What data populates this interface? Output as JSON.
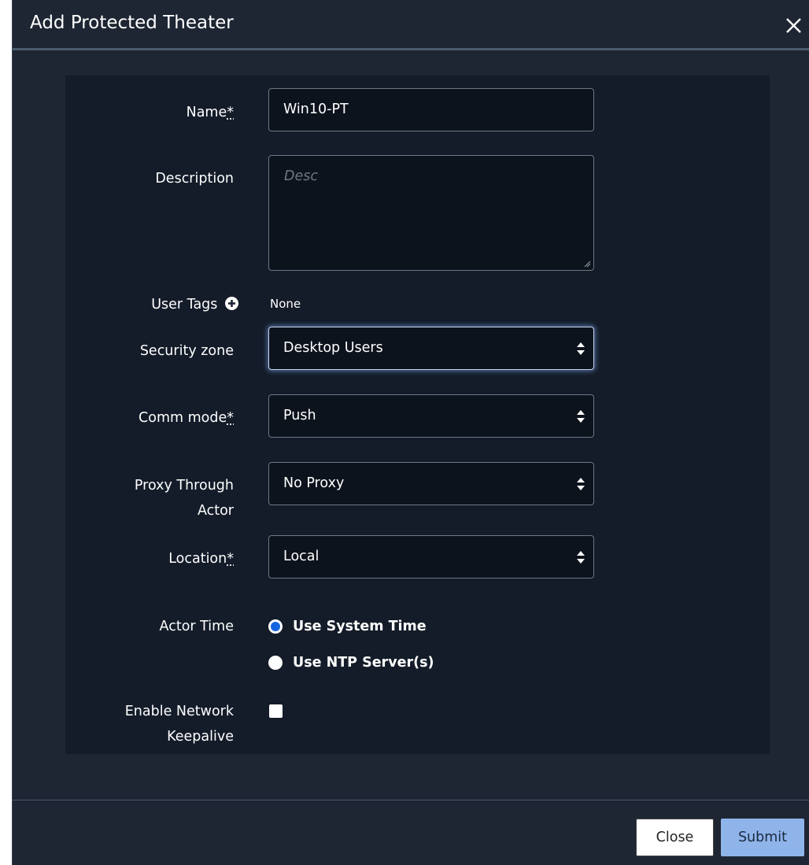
{
  "dialog": {
    "title": "Add Protected Theater"
  },
  "form": {
    "name": {
      "label": "Name",
      "required_marker": "*",
      "value": "Win10-PT"
    },
    "description": {
      "label": "Description",
      "placeholder": "Desc",
      "value": ""
    },
    "user_tags": {
      "label": "User Tags",
      "value": "None"
    },
    "security_zone": {
      "label": "Security zone",
      "value": "Desktop Users"
    },
    "comm_mode": {
      "label": "Comm mode",
      "required_marker": "*",
      "value": "Push"
    },
    "proxy_through_actor": {
      "label_line1": "Proxy Through",
      "label_line2": "Actor",
      "value": "No Proxy"
    },
    "location": {
      "label": "Location",
      "required_marker": "*",
      "value": "Local"
    },
    "actor_time": {
      "label": "Actor Time",
      "options": [
        {
          "label": "Use System Time",
          "selected": true
        },
        {
          "label": "Use NTP Server(s)",
          "selected": false
        }
      ]
    },
    "network_keepalive": {
      "label_line1": "Enable Network",
      "label_line2": "Keepalive",
      "checked": false
    }
  },
  "footer": {
    "close_label": "Close",
    "submit_label": "Submit"
  },
  "colors": {
    "modal_bg": "#1e2633",
    "panel_bg": "#141c29",
    "radio_selected": "#1565e0",
    "submit_bg": "#8fb4ea"
  },
  "icons": [
    "close-icon",
    "plus-circle-icon",
    "select-arrows-icon",
    "resize-grip-icon"
  ]
}
